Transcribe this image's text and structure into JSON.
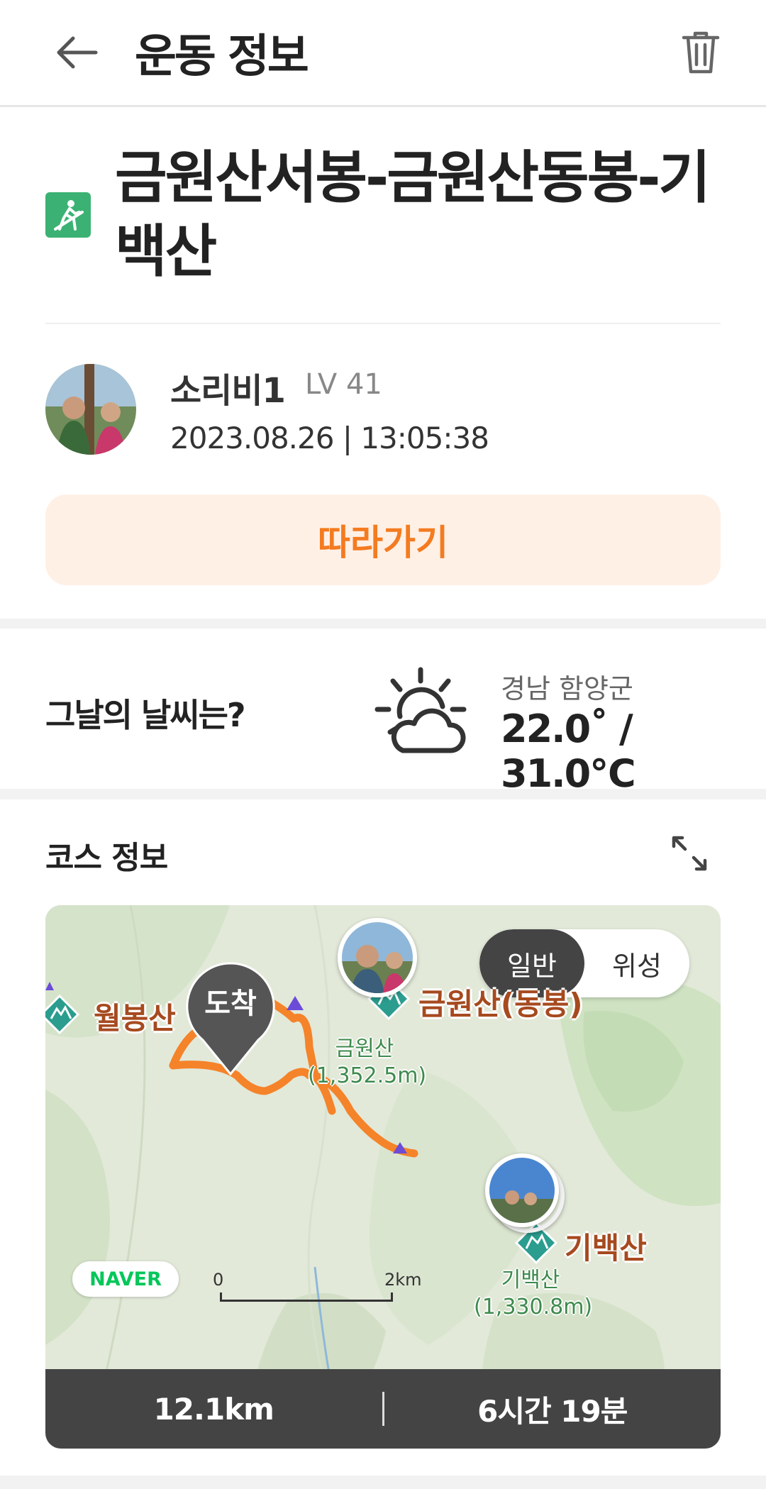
{
  "header": {
    "title": "운동 정보"
  },
  "course": {
    "title": "금원산서봉-금원산동봉-기백산",
    "icon": "hiking-icon"
  },
  "user": {
    "name": "소리비1",
    "level": "LV 41",
    "datetime": "2023.08.26 | 13:05:38"
  },
  "follow_button": "따라가기",
  "weather": {
    "question": "그날의 날씨는?",
    "icon": "partly-cloudy-sun-icon",
    "location": "경남 함양군",
    "temperature": "22.0˚ / 31.0℃"
  },
  "course_info": {
    "section_title": "코스 정보",
    "map": {
      "toggle_options": [
        "일반",
        "위성"
      ],
      "active_option": "일반",
      "arrival_marker": "도착",
      "peaks": [
        {
          "name": "월봉산"
        },
        {
          "name": "금원산(동봉)",
          "sub_name": "금원산",
          "sub_elevation": "(1,352.5m)"
        },
        {
          "name": "기백산",
          "sub_name": "기백산",
          "sub_elevation": "(1,330.8m)"
        }
      ],
      "provider": "NAVER",
      "scale_start": "0",
      "scale_end": "2km"
    },
    "stats": {
      "distance": "12.1km",
      "duration": "6시간 19분"
    }
  },
  "colors": {
    "accent": "#f47b20",
    "accent_bg": "#fff0e6",
    "route": "#f5832a",
    "peak_green": "#2a9d8f",
    "hike_icon_green": "#3bb273",
    "stats_bar": "#444444"
  }
}
